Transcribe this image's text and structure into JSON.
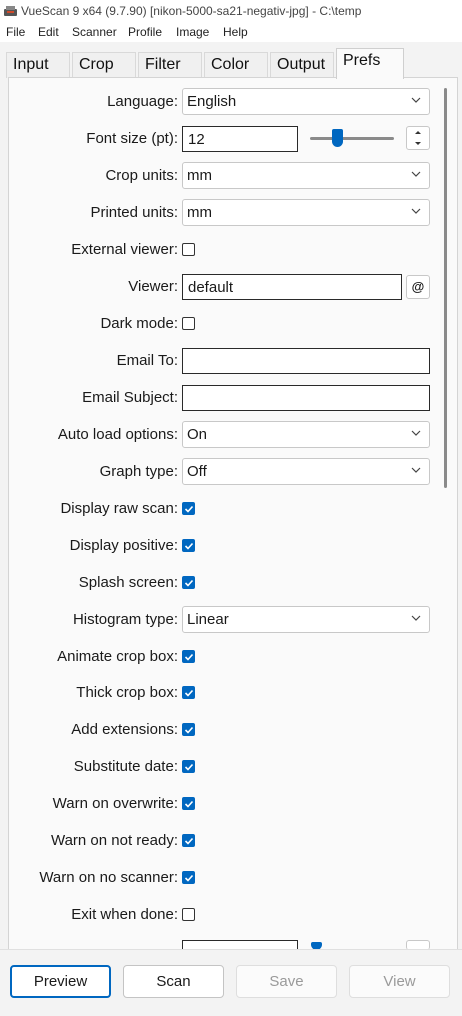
{
  "window": {
    "title": "VueScan 9 x64 (9.7.90) [nikon-5000-sa21-negativ-jpg] - C:\\temp",
    "icon": "vuescan-app-icon"
  },
  "menu": [
    "File",
    "Edit",
    "Scanner",
    "Profile",
    "Image",
    "Help"
  ],
  "tabs": [
    "Input",
    "Crop",
    "Filter",
    "Color",
    "Output",
    "Prefs"
  ],
  "active_tab": "Prefs",
  "prefs": {
    "language": {
      "label": "Language:",
      "value": "English"
    },
    "font_size": {
      "label": "Font size (pt):",
      "value": "12",
      "slider_fraction": 0.3
    },
    "crop_units": {
      "label": "Crop units:",
      "value": "mm"
    },
    "printed_units": {
      "label": "Printed units:",
      "value": "mm"
    },
    "external_viewer": {
      "label": "External viewer:",
      "checked": false
    },
    "viewer": {
      "label": "Viewer:",
      "value": "default",
      "button": "@"
    },
    "dark_mode": {
      "label": "Dark mode:",
      "checked": false
    },
    "email_to": {
      "label": "Email To:",
      "value": ""
    },
    "email_subject": {
      "label": "Email Subject:",
      "value": ""
    },
    "auto_load_options": {
      "label": "Auto load options:",
      "value": "On"
    },
    "graph_type": {
      "label": "Graph type:",
      "value": "Off"
    },
    "display_raw_scan": {
      "label": "Display raw scan:",
      "checked": true
    },
    "display_positive": {
      "label": "Display positive:",
      "checked": true
    },
    "splash_screen": {
      "label": "Splash screen:",
      "checked": true
    },
    "histogram_type": {
      "label": "Histogram type:",
      "value": "Linear"
    },
    "animate_crop_box": {
      "label": "Animate crop box:",
      "checked": true
    },
    "thick_crop_box": {
      "label": "Thick crop box:",
      "checked": true
    },
    "add_extensions": {
      "label": "Add extensions:",
      "checked": true
    },
    "substitute_date": {
      "label": "Substitute date:",
      "checked": true
    },
    "warn_on_overwrite": {
      "label": "Warn on overwrite:",
      "checked": true
    },
    "warn_on_not_ready": {
      "label": "Warn on not ready:",
      "checked": true
    },
    "warn_on_no_scanner": {
      "label": "Warn on no scanner:",
      "checked": true
    },
    "exit_when_done": {
      "label": "Exit when done:",
      "checked": false
    }
  },
  "buttons": {
    "preview": "Preview",
    "scan": "Scan",
    "save": "Save",
    "view": "View"
  },
  "colors": {
    "accent": "#0067c0",
    "panel": "#fafafa",
    "window": "#f3f3f3"
  }
}
